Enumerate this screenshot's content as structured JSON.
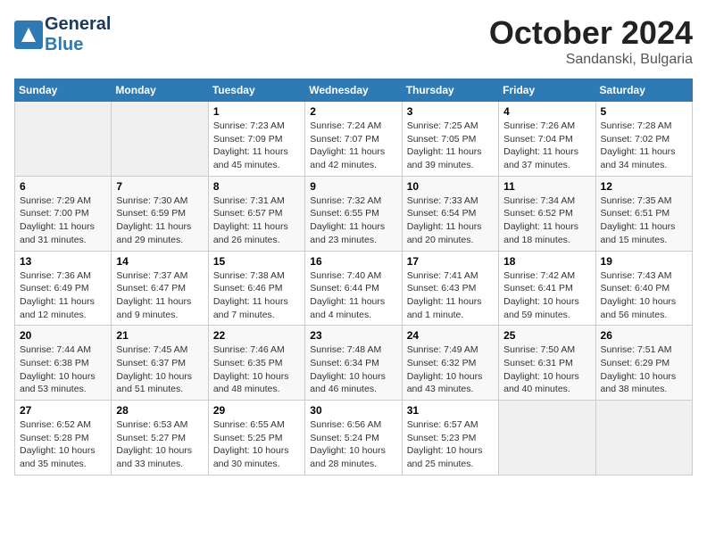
{
  "header": {
    "logo_general": "General",
    "logo_blue": "Blue",
    "month_title": "October 2024",
    "subtitle": "Sandanski, Bulgaria"
  },
  "calendar": {
    "days_of_week": [
      "Sunday",
      "Monday",
      "Tuesday",
      "Wednesday",
      "Thursday",
      "Friday",
      "Saturday"
    ],
    "weeks": [
      [
        {
          "day": "",
          "info": ""
        },
        {
          "day": "",
          "info": ""
        },
        {
          "day": "1",
          "info": "Sunrise: 7:23 AM\nSunset: 7:09 PM\nDaylight: 11 hours and 45 minutes."
        },
        {
          "day": "2",
          "info": "Sunrise: 7:24 AM\nSunset: 7:07 PM\nDaylight: 11 hours and 42 minutes."
        },
        {
          "day": "3",
          "info": "Sunrise: 7:25 AM\nSunset: 7:05 PM\nDaylight: 11 hours and 39 minutes."
        },
        {
          "day": "4",
          "info": "Sunrise: 7:26 AM\nSunset: 7:04 PM\nDaylight: 11 hours and 37 minutes."
        },
        {
          "day": "5",
          "info": "Sunrise: 7:28 AM\nSunset: 7:02 PM\nDaylight: 11 hours and 34 minutes."
        }
      ],
      [
        {
          "day": "6",
          "info": "Sunrise: 7:29 AM\nSunset: 7:00 PM\nDaylight: 11 hours and 31 minutes."
        },
        {
          "day": "7",
          "info": "Sunrise: 7:30 AM\nSunset: 6:59 PM\nDaylight: 11 hours and 29 minutes."
        },
        {
          "day": "8",
          "info": "Sunrise: 7:31 AM\nSunset: 6:57 PM\nDaylight: 11 hours and 26 minutes."
        },
        {
          "day": "9",
          "info": "Sunrise: 7:32 AM\nSunset: 6:55 PM\nDaylight: 11 hours and 23 minutes."
        },
        {
          "day": "10",
          "info": "Sunrise: 7:33 AM\nSunset: 6:54 PM\nDaylight: 11 hours and 20 minutes."
        },
        {
          "day": "11",
          "info": "Sunrise: 7:34 AM\nSunset: 6:52 PM\nDaylight: 11 hours and 18 minutes."
        },
        {
          "day": "12",
          "info": "Sunrise: 7:35 AM\nSunset: 6:51 PM\nDaylight: 11 hours and 15 minutes."
        }
      ],
      [
        {
          "day": "13",
          "info": "Sunrise: 7:36 AM\nSunset: 6:49 PM\nDaylight: 11 hours and 12 minutes."
        },
        {
          "day": "14",
          "info": "Sunrise: 7:37 AM\nSunset: 6:47 PM\nDaylight: 11 hours and 9 minutes."
        },
        {
          "day": "15",
          "info": "Sunrise: 7:38 AM\nSunset: 6:46 PM\nDaylight: 11 hours and 7 minutes."
        },
        {
          "day": "16",
          "info": "Sunrise: 7:40 AM\nSunset: 6:44 PM\nDaylight: 11 hours and 4 minutes."
        },
        {
          "day": "17",
          "info": "Sunrise: 7:41 AM\nSunset: 6:43 PM\nDaylight: 11 hours and 1 minute."
        },
        {
          "day": "18",
          "info": "Sunrise: 7:42 AM\nSunset: 6:41 PM\nDaylight: 10 hours and 59 minutes."
        },
        {
          "day": "19",
          "info": "Sunrise: 7:43 AM\nSunset: 6:40 PM\nDaylight: 10 hours and 56 minutes."
        }
      ],
      [
        {
          "day": "20",
          "info": "Sunrise: 7:44 AM\nSunset: 6:38 PM\nDaylight: 10 hours and 53 minutes."
        },
        {
          "day": "21",
          "info": "Sunrise: 7:45 AM\nSunset: 6:37 PM\nDaylight: 10 hours and 51 minutes."
        },
        {
          "day": "22",
          "info": "Sunrise: 7:46 AM\nSunset: 6:35 PM\nDaylight: 10 hours and 48 minutes."
        },
        {
          "day": "23",
          "info": "Sunrise: 7:48 AM\nSunset: 6:34 PM\nDaylight: 10 hours and 46 minutes."
        },
        {
          "day": "24",
          "info": "Sunrise: 7:49 AM\nSunset: 6:32 PM\nDaylight: 10 hours and 43 minutes."
        },
        {
          "day": "25",
          "info": "Sunrise: 7:50 AM\nSunset: 6:31 PM\nDaylight: 10 hours and 40 minutes."
        },
        {
          "day": "26",
          "info": "Sunrise: 7:51 AM\nSunset: 6:29 PM\nDaylight: 10 hours and 38 minutes."
        }
      ],
      [
        {
          "day": "27",
          "info": "Sunrise: 6:52 AM\nSunset: 5:28 PM\nDaylight: 10 hours and 35 minutes."
        },
        {
          "day": "28",
          "info": "Sunrise: 6:53 AM\nSunset: 5:27 PM\nDaylight: 10 hours and 33 minutes."
        },
        {
          "day": "29",
          "info": "Sunrise: 6:55 AM\nSunset: 5:25 PM\nDaylight: 10 hours and 30 minutes."
        },
        {
          "day": "30",
          "info": "Sunrise: 6:56 AM\nSunset: 5:24 PM\nDaylight: 10 hours and 28 minutes."
        },
        {
          "day": "31",
          "info": "Sunrise: 6:57 AM\nSunset: 5:23 PM\nDaylight: 10 hours and 25 minutes."
        },
        {
          "day": "",
          "info": ""
        },
        {
          "day": "",
          "info": ""
        }
      ]
    ]
  }
}
